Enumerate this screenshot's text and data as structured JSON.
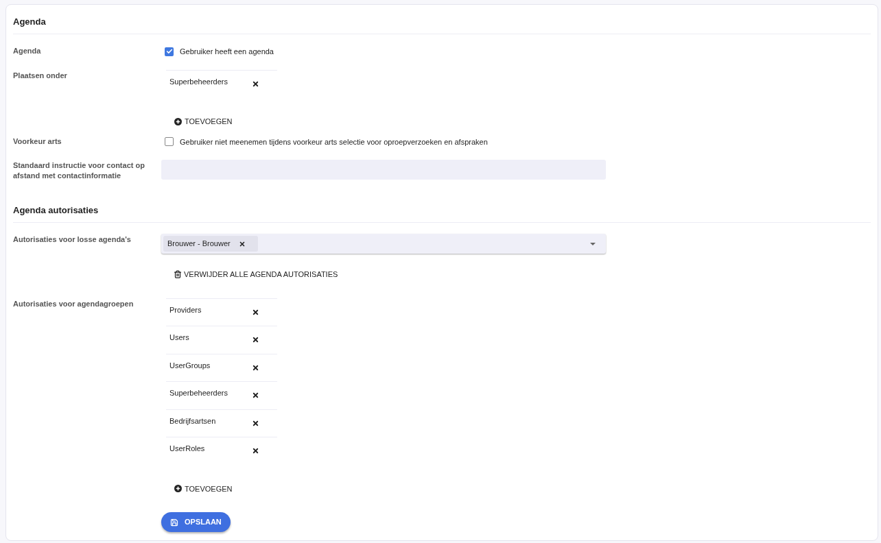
{
  "sections": [
    {
      "title": "Agenda",
      "rows": [
        {
          "kind": "checkbox",
          "label": "Agenda",
          "text": "Gebruiker heeft een agenda",
          "checked": true
        },
        {
          "kind": "list",
          "label": "Plaatsen onder",
          "items": [
            "Superbeheerders"
          ],
          "add_label": "TOEVOEGEN"
        },
        {
          "kind": "checkbox",
          "label": "Voorkeur arts",
          "text": "Gebruiker niet meenemen tijdens voorkeur arts selectie voor oproepverzoeken en afspraken",
          "checked": false
        },
        {
          "kind": "textarea",
          "label": "Standaard instructie voor contact op afstand met contactinformatie"
        }
      ]
    },
    {
      "title": "Agenda autorisaties",
      "rows": [
        {
          "kind": "select",
          "label": "Autorisaties voor losse agenda's",
          "chips": [
            "Brouwer - Brouwer"
          ],
          "action_label": "VERWIJDER ALLE AGENDA AUTORISATIES"
        },
        {
          "kind": "list",
          "label": "Autorisaties voor agendagroepen",
          "items": [
            "Providers",
            "Users",
            "UserGroups",
            "Superbeheerders",
            "Bedrijfsartsen",
            "UserRoles"
          ],
          "add_label": "TOEVOEGEN"
        }
      ]
    }
  ],
  "save_label": "OPSLAAN"
}
